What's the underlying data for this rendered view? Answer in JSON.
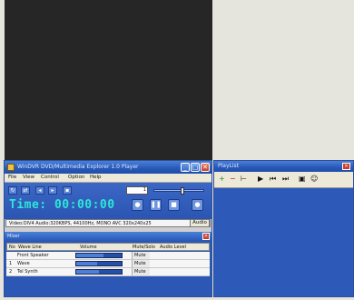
{
  "player": {
    "title": "WinDVR DVD/Multimedia Explorer 1.0 Player",
    "menu": [
      "File",
      "View",
      "Control",
      "Option",
      "Help"
    ],
    "track_value": "1",
    "volume_level": 0.55,
    "time": "Time: 00:00:00",
    "transport_icons": [
      "record-icon",
      "pause-icon",
      "stop-icon",
      "eject-icon"
    ],
    "info": "Video:DIV4  Audio:320KBPS, 44100Hz, MONO  AVC  320x240x25",
    "info_button": "Audio"
  },
  "mixer": {
    "title": "Mixer",
    "columns": [
      "No",
      "Wave Line",
      "Volume",
      "Mute/Solo",
      "Audio Level"
    ],
    "rows": [
      {
        "no": "",
        "name": "Front Speaker",
        "level": 0.6,
        "mute": "Mute"
      },
      {
        "no": "1",
        "name": "Wave",
        "level": 0.45,
        "mute": "Mute"
      },
      {
        "no": "2",
        "name": "Tel Synth",
        "level": 0.5,
        "mute": "Mute"
      }
    ]
  },
  "playlist": {
    "title": "PlayList",
    "toolbar_icons": [
      "add-icon",
      "remove-icon",
      "move-icon",
      "play-icon",
      "prev-icon",
      "next-icon",
      "save-icon",
      "users-icon"
    ]
  },
  "colors": {
    "accent": "#2a55b3",
    "titlebar": "#2858b8",
    "time_text": "#2ee6d8"
  }
}
